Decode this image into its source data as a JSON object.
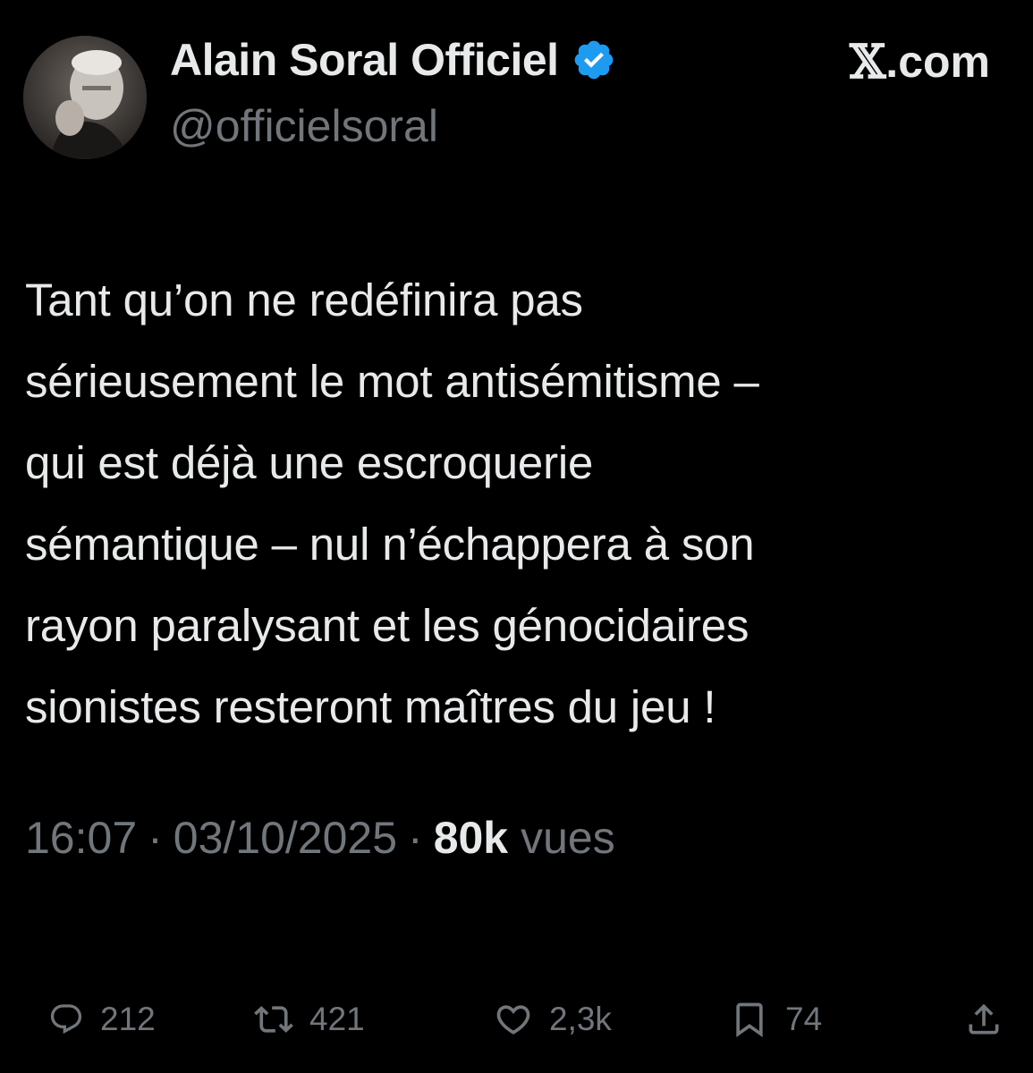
{
  "author": {
    "display_name": "Alain Soral Officiel",
    "handle": "@officielsoral",
    "verified": true
  },
  "source": {
    "glyph": "𝕏",
    "label": ".com"
  },
  "tweet": {
    "lines": [
      "Tant qu’on ne redéfinira pas",
      "sérieusement le mot antisémitisme –",
      "qui est déjà une escroquerie",
      "sémantique – nul n’échappera à son",
      "rayon paralysant et les génocidaires",
      "sionistes resteront maîtres du jeu !"
    ]
  },
  "meta": {
    "time": "16:07",
    "separator": "·",
    "date": "03/10/2025",
    "views_count": "80k",
    "views_label": "vues"
  },
  "actions": {
    "replies": "212",
    "reposts": "421",
    "likes": "2,3k",
    "bookmarks": "74"
  },
  "colors": {
    "background": "#000000",
    "primary_text": "#e7e9ea",
    "secondary_text": "#71767b",
    "verified_badge": "#1d9bf0"
  },
  "icons": {
    "verified": "verified-badge-icon",
    "reply": "reply-icon",
    "repost": "repost-icon",
    "like": "heart-icon",
    "bookmark": "bookmark-icon",
    "share": "share-icon"
  }
}
